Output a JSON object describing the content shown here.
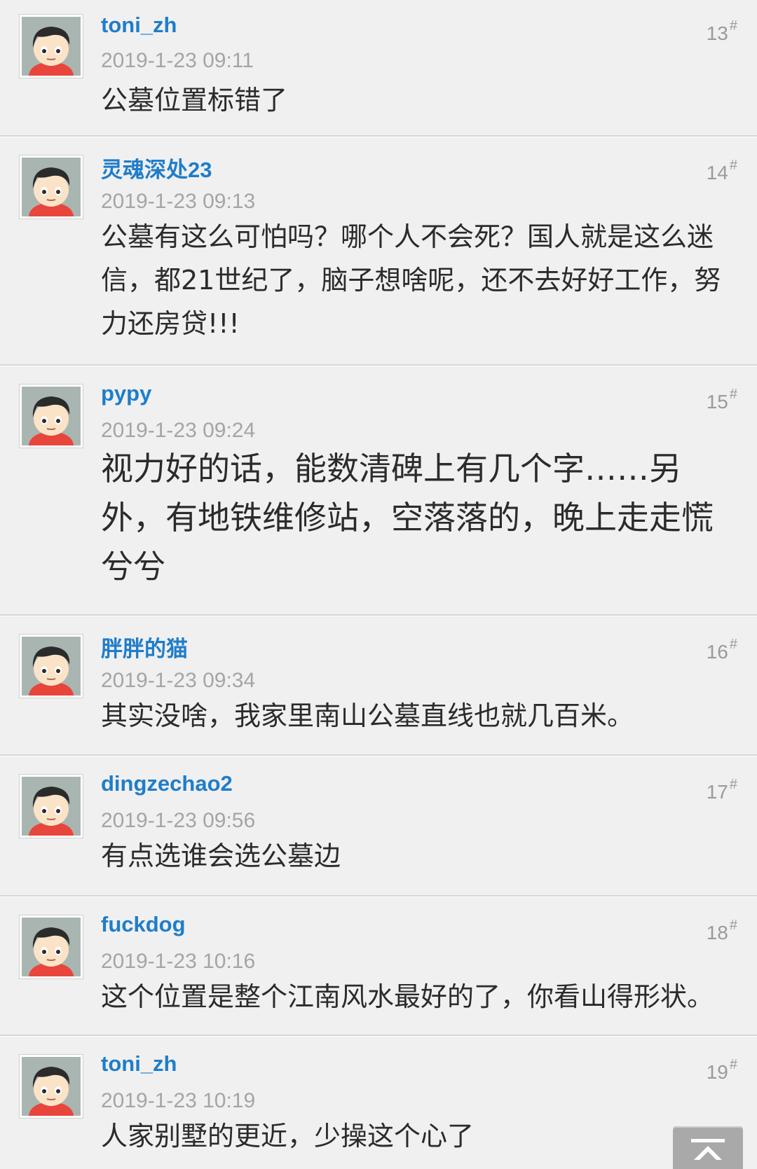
{
  "posts": [
    {
      "username": "toni_zh",
      "floor": "13",
      "floor_mark": "#",
      "time": "2019-1-23 09:11",
      "content": "公墓位置标错了"
    },
    {
      "username": "灵魂深处23",
      "floor": "14",
      "floor_mark": "#",
      "time": "2019-1-23 09:13",
      "content": "公墓有这么可怕吗？哪个人不会死？国人就是这么迷信，都21世纪了，脑子想啥呢，还不去好好工作，努力还房贷!!!"
    },
    {
      "username": "pypy",
      "floor": "15",
      "floor_mark": "#",
      "time": "2019-1-23 09:24",
      "content": "视力好的话，能数清碑上有几个字……另外，有地铁维修站，空落落的，晚上走走慌兮兮"
    },
    {
      "username": "胖胖的猫",
      "floor": "16",
      "floor_mark": "#",
      "time": "2019-1-23 09:34",
      "content": "其实没啥，我家里南山公墓直线也就几百米。"
    },
    {
      "username": "dingzechao2",
      "floor": "17",
      "floor_mark": "#",
      "time": "2019-1-23 09:56",
      "content": "有点选谁会选公墓边"
    },
    {
      "username": "fuckdog",
      "floor": "18",
      "floor_mark": "#",
      "time": "2019-1-23 10:16",
      "content": "这个位置是整个江南风水最好的了，你看山得形状。"
    },
    {
      "username": "toni_zh",
      "floor": "19",
      "floor_mark": "#",
      "time": "2019-1-23 10:19",
      "content": "人家别墅的更近，少操这个心了"
    }
  ],
  "icons": {
    "avatar": "default-boy-avatar-icon",
    "back_to_top": "arrow-up-icon"
  },
  "colors": {
    "username": "#1f7dc9",
    "timestamp": "#a5a5a5",
    "content": "#2b2b2b",
    "background": "#f0f0f0"
  }
}
